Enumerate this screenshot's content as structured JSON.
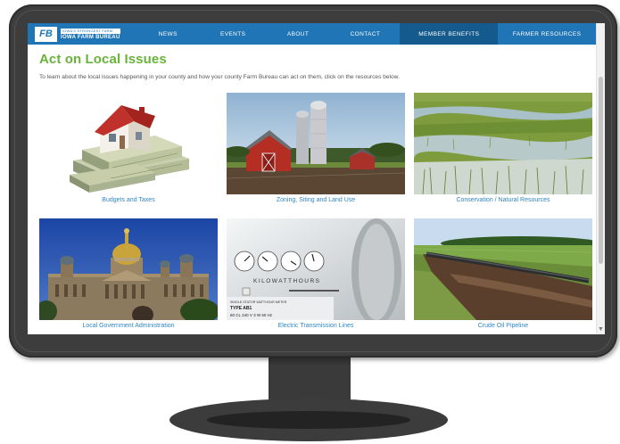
{
  "site": {
    "logo_mark": "FB",
    "logo_tagline": "IOWA'S STRONGEST FARM",
    "logo_name": "IOWA FARM BUREAU"
  },
  "nav": {
    "items": [
      {
        "label": "NEWS",
        "active": false
      },
      {
        "label": "EVENTS",
        "active": false
      },
      {
        "label": "ABOUT",
        "active": false
      },
      {
        "label": "CONTACT",
        "active": false
      },
      {
        "label": "MEMBER BENEFITS",
        "active": true
      },
      {
        "label": "FARMER RESOURCES",
        "active": false
      }
    ]
  },
  "page": {
    "title": "Act on Local Issues",
    "intro": "To learn about the local issues happening in your county and how your county Farm Bureau can act on them, click on the resources below."
  },
  "tiles": [
    {
      "caption": "Budgets and Taxes",
      "image": "house-on-money-image"
    },
    {
      "caption": "Zoning, Siting and Land Use",
      "image": "red-barn-silos-image"
    },
    {
      "caption": "Conservation / Natural Resources",
      "image": "wetland-field-image"
    },
    {
      "caption": "Local Government Administration",
      "image": "capitol-building-image"
    },
    {
      "caption": "Electric Transmission Lines",
      "image": "electric-meter-image"
    },
    {
      "caption": "Crude Oil Pipeline",
      "image": "pipeline-field-image"
    }
  ],
  "meter": {
    "brand": "SINGLE-STATOR WATTHOUR METER",
    "label": "KILOWATTHOURS",
    "type": "TYPE AB1",
    "specs": "60 CL   240 V   3 W   60 Hz"
  },
  "colors": {
    "nav_blue": "#1f75b6",
    "nav_active": "#155a8d",
    "title_green": "#69b33a",
    "link_blue": "#2f86c4",
    "monitor": "#3d3d3d"
  }
}
